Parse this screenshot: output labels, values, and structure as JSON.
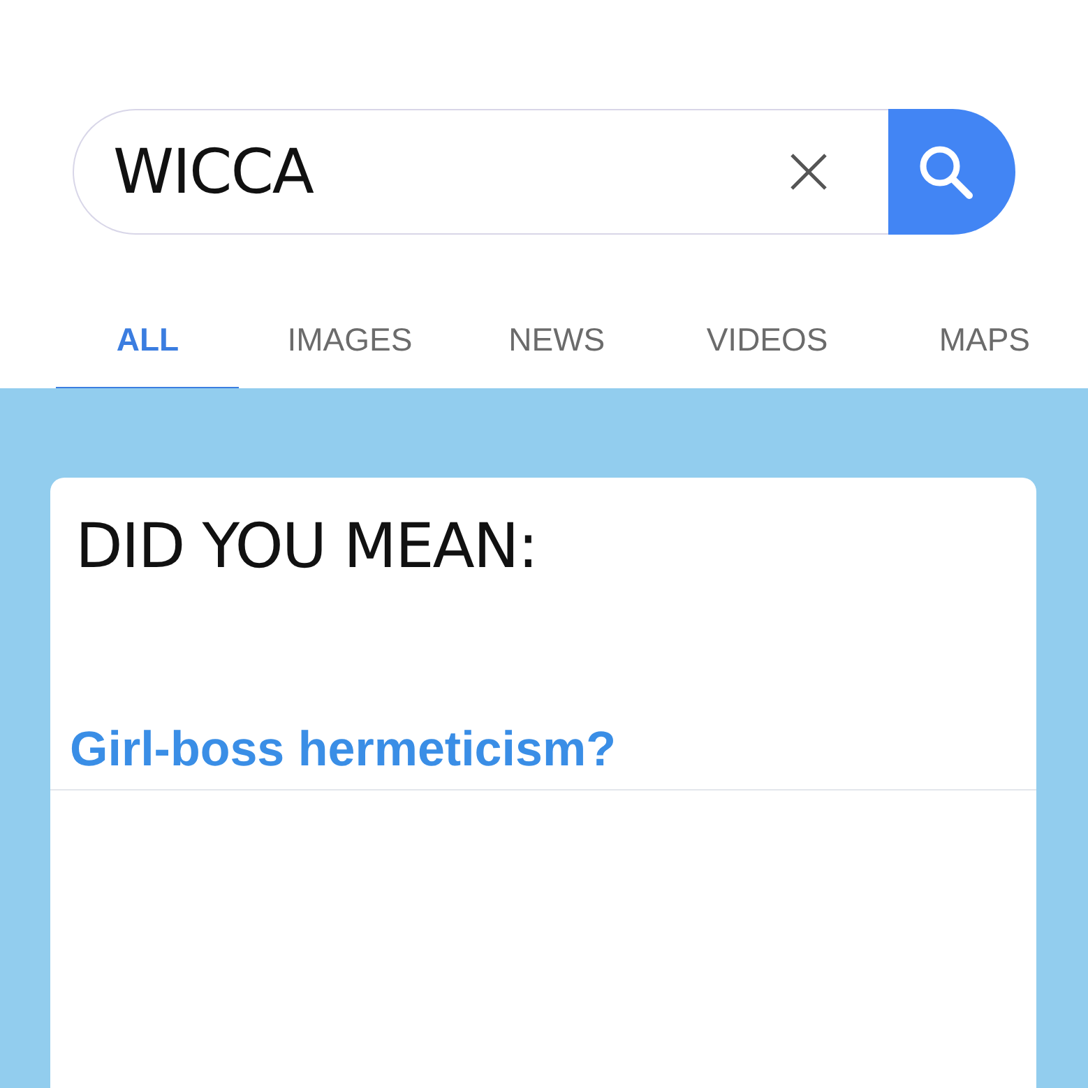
{
  "search": {
    "value": "WICCA"
  },
  "tabs": [
    {
      "label": "ALL",
      "selected": true
    },
    {
      "label": "IMAGES",
      "selected": false
    },
    {
      "label": "NEWS",
      "selected": false
    },
    {
      "label": "VIDEOS",
      "selected": false
    },
    {
      "label": "MAPS",
      "selected": false
    }
  ],
  "card": {
    "heading": "DID YOU MEAN:",
    "suggestion": "Girl-boss hermeticism?"
  }
}
